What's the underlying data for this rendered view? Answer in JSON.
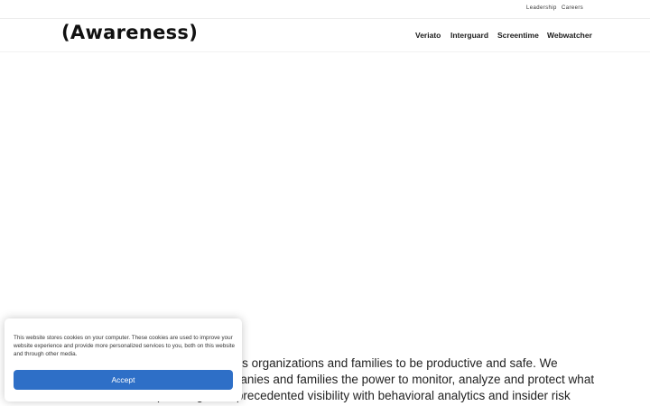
{
  "topbar": {
    "links": [
      "Leadership",
      "Careers"
    ]
  },
  "header": {
    "logo": "(Awareness)",
    "nav": [
      "Veriato",
      "Interguard",
      "Screentime",
      "Webwatcher"
    ]
  },
  "main": {
    "intro": "Awareness Technologies empowers organizations and families to be productive and safe. We provide a platform that gives companies and families the power to monitor, analyze and protect what matters most. Companies gain unprecedented visibility with behavioral analytics and insider risk management with Veriato and Interguard,"
  },
  "cookie_banner": {
    "text": "This website stores cookies on your computer. These cookies are used to improve your website experience and provide more personalized services to you, both on this website and through other media.",
    "accept_label": "Accept"
  },
  "colors": {
    "accent": "#2e6fc7",
    "text": "#111111"
  }
}
